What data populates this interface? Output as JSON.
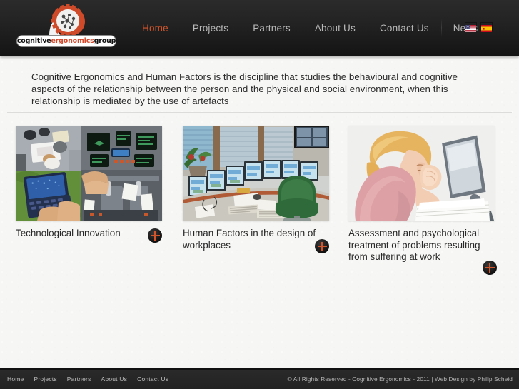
{
  "header": {
    "logo": {
      "word_1": "cognitive",
      "word_2": "ergonomics",
      "word_3": "group",
      "mark_alt": "head-in-gear-logo"
    },
    "nav": [
      {
        "label": "Home",
        "active": true
      },
      {
        "label": "Projects",
        "active": false
      },
      {
        "label": "Partners",
        "active": false
      },
      {
        "label": "About Us",
        "active": false
      },
      {
        "label": "Contact Us",
        "active": false
      },
      {
        "label": "News",
        "active": false
      }
    ],
    "languages": [
      {
        "name": "us-flag-icon",
        "title": "English"
      },
      {
        "name": "spain-flag-icon",
        "title": "Espanol"
      }
    ]
  },
  "main": {
    "intro": "Cognitive Ergonomics and Human Factors is the discipline that studies the behavioural and cognitive aspects of the relationship between the person and the physical and social environment, when this relationship is mediated by the use of artefacts",
    "cards": [
      {
        "caption": "Technological Innovation",
        "image_alt": "collage-workspace-handheld-device-aircraft-cockpit",
        "expand_label": "+"
      },
      {
        "caption": "Human Factors in the design of workplaces",
        "image_alt": "control-room-with-monitor-wall-and-green-chair",
        "expand_label": "+"
      },
      {
        "caption": "Assessment and psychological treatment of problems resulting from suffering at work",
        "image_alt": "stressed-woman-at-computer-with-papers",
        "expand_label": "+"
      }
    ]
  },
  "footer": {
    "nav": [
      "Home",
      "Projects",
      "Partners",
      "About Us",
      "Contact Us"
    ],
    "copyright": "© All Rights Reserved - Cognitive Ergonomics - 2011 | Web Design by Philip Scheid"
  },
  "colors": {
    "accent": "#d2552c",
    "header_bg": "#1c1c1c",
    "page_bg": "#f6f6f4",
    "footer_bg": "#262626",
    "text": "#272727"
  }
}
